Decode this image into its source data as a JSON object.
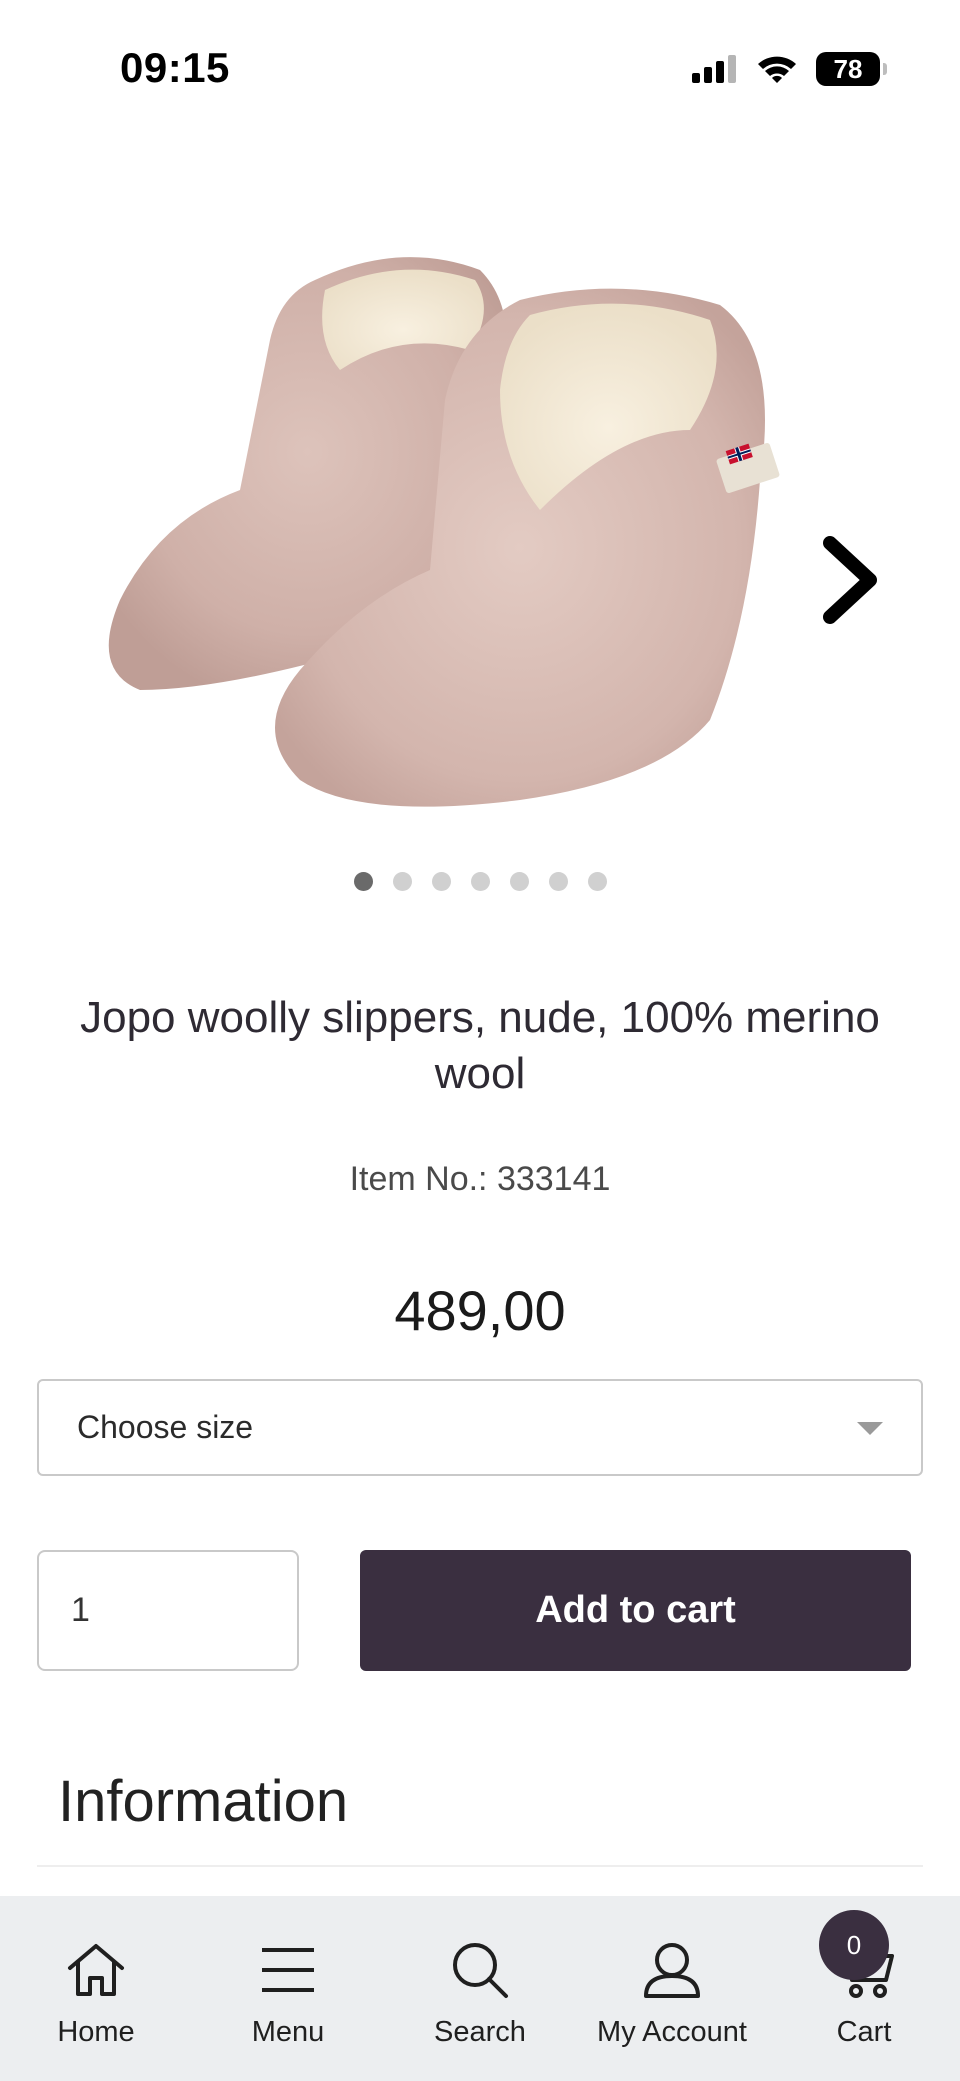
{
  "status_bar": {
    "time": "09:15",
    "battery": "78"
  },
  "product": {
    "title": "Jopo woolly slippers, nude, 100% merino wool",
    "item_no": "Item No.: 333141",
    "price": "489,00",
    "image_count": 7,
    "active_image": 1
  },
  "size_select": {
    "placeholder": "Choose size"
  },
  "quantity": {
    "value": "1"
  },
  "add_to_cart_label": "Add to cart",
  "information_heading": "Information",
  "nav": {
    "home": "Home",
    "menu": "Menu",
    "search": "Search",
    "account": "My Account",
    "cart": "Cart",
    "cart_count": "0"
  },
  "colors": {
    "primary": "#3a2f40",
    "nav_background": "#eceef0",
    "slipper_pink": "#d4b6ae",
    "wool_cream": "#f3ead8"
  },
  "icons": [
    "signal-icon",
    "wifi-icon",
    "battery-icon",
    "next-arrow-icon",
    "home-icon",
    "menu-icon",
    "search-icon",
    "account-icon",
    "cart-icon",
    "chevron-down-icon"
  ]
}
